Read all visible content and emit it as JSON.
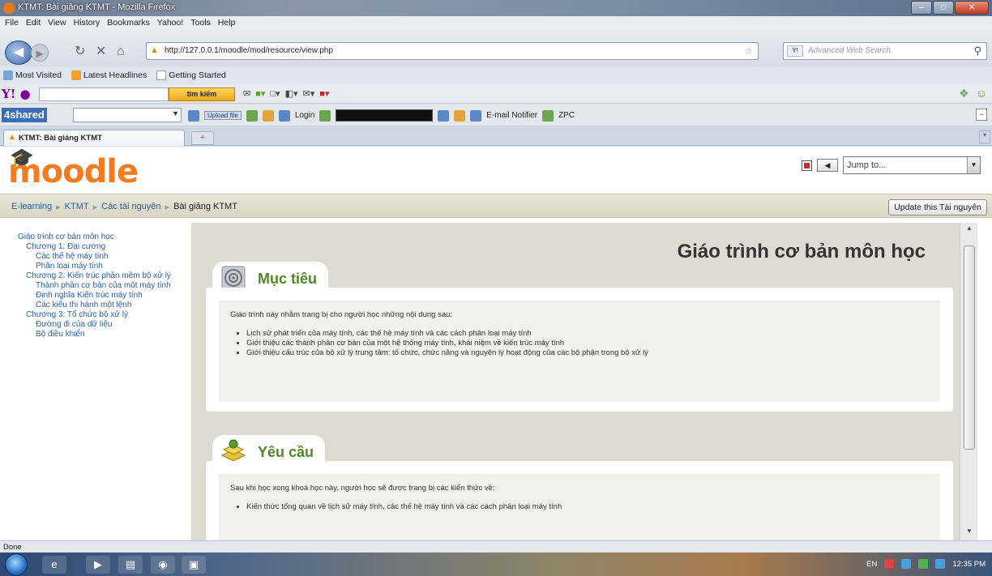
{
  "window": {
    "title": "KTMT: Bài giảng KTMT - Mozilla Firefox"
  },
  "menu": [
    "File",
    "Edit",
    "View",
    "History",
    "Bookmarks",
    "Yahoo!",
    "Tools",
    "Help"
  ],
  "nav": {
    "url": "http://127.0.0.1/moodle/mod/resource/view.php",
    "search_placeholder": "Advanced Web Search"
  },
  "bookmarks": [
    "Most Visited",
    "Latest Headlines",
    "Getting Started"
  ],
  "yahoo_toolbar": {
    "search_button": "tìm kiếm"
  },
  "addon_toolbar": {
    "logo": "4shared",
    "upload_label": "Upload file",
    "login_label": "Login",
    "email_label": "E-mail Notifier",
    "zpc_label": "ZPC"
  },
  "tabs": [
    {
      "label": "KTMT: Bài giảng KTMT"
    }
  ],
  "moodle": {
    "logo_text": "moodle",
    "jump_to": "Jump to...",
    "breadcrumb": [
      "E-learning",
      "KTMT",
      "Các tài nguyên",
      "Bài giảng KTMT"
    ],
    "update_button": "Update this Tài nguyên"
  },
  "toc": [
    {
      "text": "Giáo trình cơ bản môn học",
      "level": 1
    },
    {
      "text": "Chương 1: Đại cương",
      "level": 2
    },
    {
      "text": "Các thế hệ máy tính",
      "level": 3
    },
    {
      "text": "Phân loại máy tính",
      "level": 3
    },
    {
      "text": "Chương 2: Kiến trúc phần mềm bộ xử lý",
      "level": 2
    },
    {
      "text": "Thành phần cơ bản của một máy tính",
      "level": 3
    },
    {
      "text": "Định nghĩa Kiến trúc máy tính",
      "level": 3
    },
    {
      "text": "Các kiểu thi hành một lệnh",
      "level": 3
    },
    {
      "text": "Chương 3: Tổ chức bộ xử lý",
      "level": 2
    },
    {
      "text": "Đường đi của dữ liệu",
      "level": 3
    },
    {
      "text": "Bộ điều khiển",
      "level": 3
    }
  ],
  "page": {
    "title": "Giáo trình cơ bản môn học",
    "sections": [
      {
        "heading": "Mục tiêu",
        "intro": "Giáo trình này nhằm trang bị cho người học những nội dung sau:",
        "bullets": [
          "Lịch sử phát triển của máy tính, các thế hệ máy tính và các cách phân loại máy tính",
          "Giới thiệu các thành phần cơ bản của một hệ thống máy tính, khái niệm về kiến trúc máy tính",
          "Giới thiệu cấu trúc của bộ xử lý trung tâm: tổ chức, chức năng và nguyên lý hoạt động của các bộ phận trong bộ xử lý"
        ]
      },
      {
        "heading": "Yêu cầu",
        "intro": "Sau khi học xong khoá học này, người học sẽ được trang bị các kiến thức về:",
        "bullets": [
          "Kiến thức tổng quan về lịch sử máy tính, các thế hệ máy tính và các cách phân loại máy tính"
        ]
      }
    ]
  },
  "status": {
    "text": "Done"
  },
  "taskbar": {
    "lang": "EN",
    "clock": "12:35 PM"
  },
  "colors": {
    "moodle_orange": "#f47c20",
    "section_green": "#4d8a23",
    "link_blue": "#2660a8"
  }
}
